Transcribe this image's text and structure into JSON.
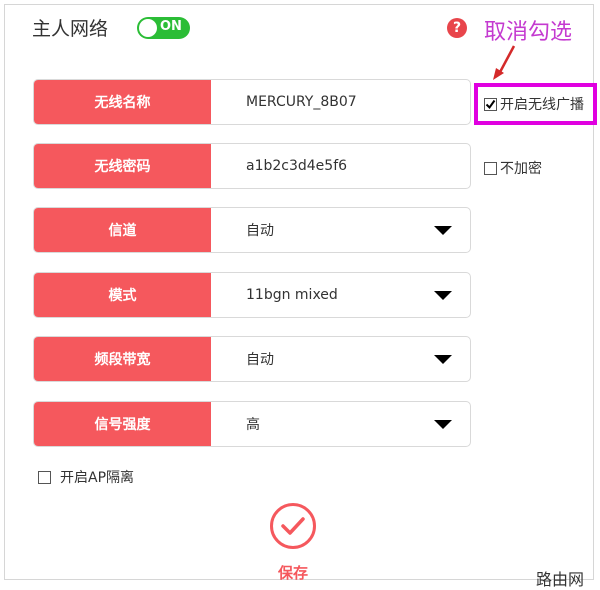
{
  "header": {
    "title": "主人网络",
    "toggle_label": "ON",
    "help_glyph": "?"
  },
  "annotation": {
    "text": "取消勾选",
    "color": "#c43ad0"
  },
  "rows": [
    {
      "label": "无线名称",
      "value": "MERCURY_8B07",
      "dropdown": false
    },
    {
      "label": "无线密码",
      "value": "a1b2c3d4e5f6",
      "dropdown": false
    },
    {
      "label": "信道",
      "value": "自动",
      "dropdown": true
    },
    {
      "label": "模式",
      "value": "11bgn mixed",
      "dropdown": true
    },
    {
      "label": "频段带宽",
      "value": "自动",
      "dropdown": true
    },
    {
      "label": "信号强度",
      "value": "高",
      "dropdown": true
    }
  ],
  "options": {
    "broadcast": {
      "label": "开启无线广播",
      "checked": true
    },
    "no_encrypt": {
      "label": "不加密",
      "checked": false
    },
    "ap_isolation": {
      "label": "开启AP隔离",
      "checked": false
    }
  },
  "save": {
    "label": "保存"
  },
  "watermark": "路由网",
  "colors": {
    "accent": "#f5585d",
    "toggle_on": "#2bbd36",
    "highlight": "#e000e0"
  }
}
